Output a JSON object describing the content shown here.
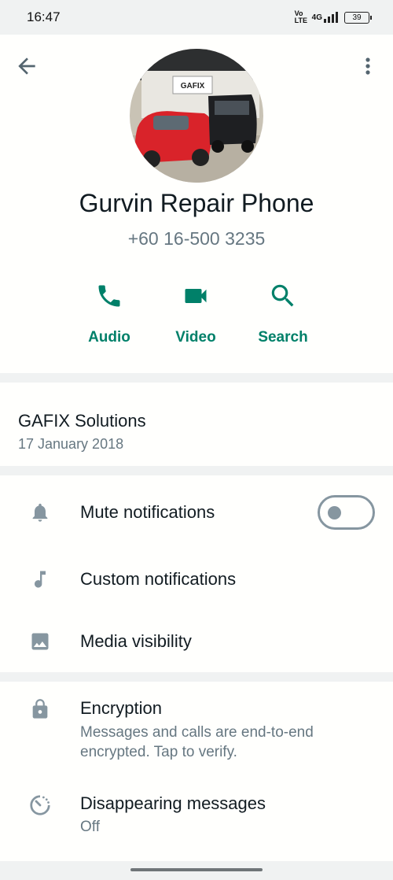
{
  "status": {
    "time": "16:47",
    "network": "4G",
    "volte": "Vo LTE",
    "battery": "39"
  },
  "contact": {
    "name": "Gurvin Repair Phone",
    "phone": "+60 16-500 3235",
    "avatar_sign": "GAFIX"
  },
  "actions": [
    {
      "label": "Audio",
      "icon": "phone-icon"
    },
    {
      "label": "Video",
      "icon": "video-icon"
    },
    {
      "label": "Search",
      "icon": "search-icon"
    }
  ],
  "about": {
    "text": "GAFIX Solutions",
    "date": "17 January 2018"
  },
  "settings": [
    {
      "label": "Mute notifications",
      "icon": "bell-icon",
      "toggle": false
    },
    {
      "label": "Custom notifications",
      "icon": "music-note-icon"
    },
    {
      "label": "Media visibility",
      "icon": "image-icon"
    }
  ],
  "security": {
    "encryption_title": "Encryption",
    "encryption_sub_1": "Messages and calls are end-to-end",
    "encryption_sub_2": "encrypted. Tap to verify.",
    "disappearing_title": "Disappearing messages",
    "disappearing_value": "Off"
  },
  "colors": {
    "accent": "#008069",
    "secondary_text": "#667781",
    "icon_gray": "#8696a0"
  }
}
